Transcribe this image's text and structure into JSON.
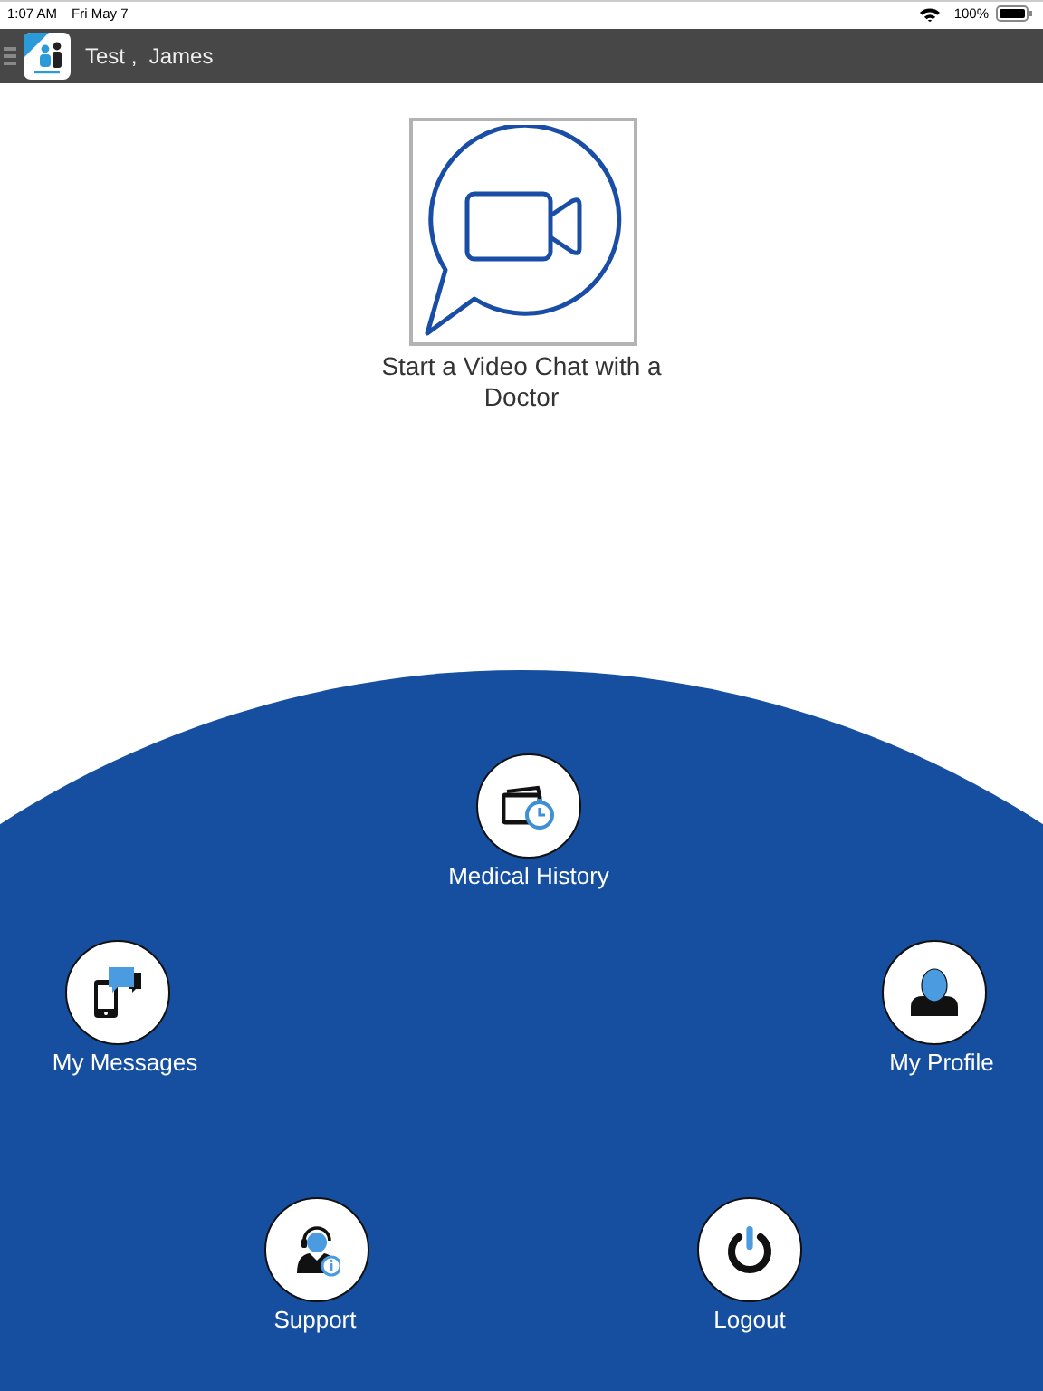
{
  "status_bar": {
    "time": "1:07 AM",
    "date": "Fri May 7",
    "battery": "100%"
  },
  "header": {
    "title": "Test ,  James"
  },
  "video_chat": {
    "label": "Start a Video Chat with a Doctor"
  },
  "menu": [
    {
      "label": "Medical History"
    },
    {
      "label": "My Messages"
    },
    {
      "label": "My Profile"
    },
    {
      "label": "Support"
    },
    {
      "label": "Logout"
    }
  ]
}
